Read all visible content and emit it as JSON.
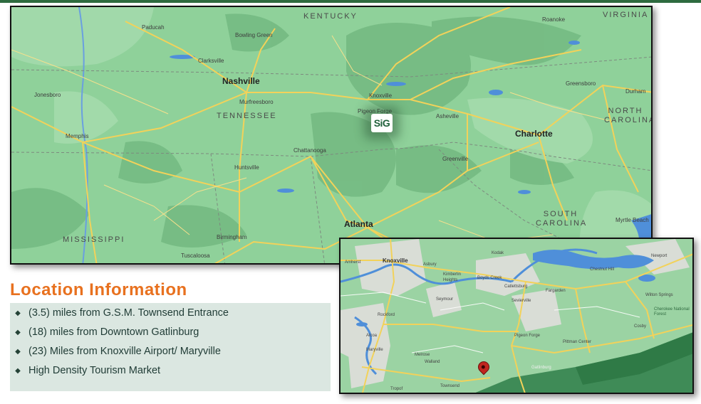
{
  "main_map": {
    "states": [
      "KENTUCKY",
      "VIRGINIA",
      "TENNESSEE",
      "NORTH CAROLINA",
      "SOUTH CAROLINA",
      "MISSISSIPPI"
    ],
    "cities": [
      "Paducah",
      "Bowling Green",
      "Clarksville",
      "Nashville",
      "Murfreesboro",
      "Jonesboro",
      "Memphis",
      "Huntsville",
      "Chattanooga",
      "Knoxville",
      "Pigeon Forge",
      "Asheville",
      "Greenville",
      "Charlotte",
      "Greensboro",
      "Durham",
      "Roanoke",
      "Atlanta",
      "Birmingham",
      "Tuscaloosa",
      "Myrtle Beach"
    ],
    "marker_logo": "SiG"
  },
  "inset_map": {
    "places": [
      "Knoxville",
      "Amherst",
      "Asbury",
      "Kodak",
      "Newport",
      "Kimberlin Heights",
      "Boyds Creek",
      "Chestnut Hill",
      "Catlettsburg",
      "Seymour",
      "Fargarden",
      "Sevierville",
      "Wilton Springs",
      "Rockford",
      "Alcoa",
      "Maryville",
      "Pigeon Forge",
      "Cosby",
      "Pittman Center",
      "Melrose",
      "Walland",
      "Gatlinburg",
      "Townsend",
      "Tropof",
      "Cherokee National Forest"
    ],
    "pin_icon": "location-pin-icon"
  },
  "location_info": {
    "title": "Location Information",
    "items": [
      "(3.5) miles from G.S.M. Townsend Entrance",
      "(18) miles from Downtown Gatlinburg",
      "(23) Miles from Knoxville Airport/ Maryville",
      "High Density Tourism Market"
    ],
    "bullet_icon": "diamond-bullet-icon"
  },
  "colors": {
    "accent": "#e8711f",
    "map_green": "#8fd19a",
    "road": "#f2d25a",
    "water": "#4f8fd9",
    "info_bg": "#dbe7e1",
    "rule": "#2e6b3f"
  }
}
